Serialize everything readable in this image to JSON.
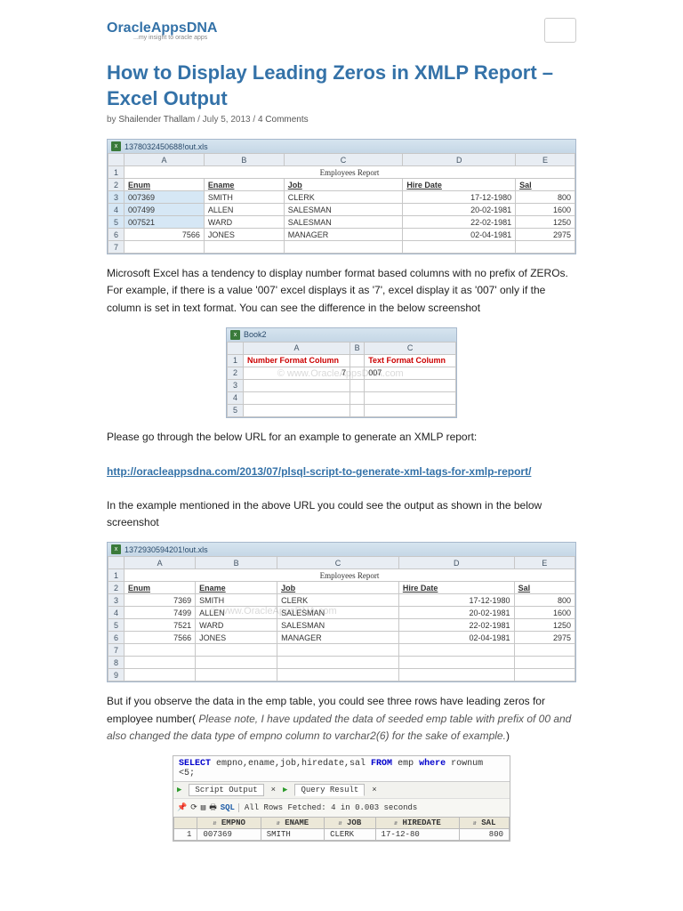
{
  "site": {
    "logo_main": "OracleAppsDNA",
    "logo_sub": "...my insight to oracle apps"
  },
  "article": {
    "title": "How to Display Leading Zeros in XMLP Report – Excel Output",
    "meta": {
      "by": "by",
      "author": "Shailender Thallam",
      "date": "July 5, 2013",
      "comments": "4 Comments"
    },
    "p1": "Microsoft Excel has a tendency to display number format based columns with no prefix of ZEROs. For example, if there is a value '007' excel displays it as '7', excel display it as '007' only if the column is set in text format. You can see the difference in the below screenshot",
    "p2": "Please go through the below URL for an example to generate an XMLP report:",
    "link": "http://oracleappsdna.com/2013/07/plsql-script-to-generate-xml-tags-for-xmlp-report/",
    "p3": "In the example mentioned in the above URL you could see the output as shown in the below screenshot",
    "p4_a": "But if you observe the data in the emp table, you could see three rows have leading zeros for employee number(",
    "p4_b": " Please note, I have updated the data of seeded emp table with prefix of 00 and also changed the data type of empno column to varchar2(6) for the sake of example.",
    "p4_c": ")"
  },
  "excel1": {
    "filename": "1378032450688!out.xls",
    "title": "Employees Report",
    "cols": [
      "A",
      "B",
      "C",
      "D",
      "E"
    ],
    "headers": [
      "Enum",
      "Ename",
      "Job",
      "Hire Date",
      "Sal"
    ],
    "rows": [
      [
        "007369",
        "SMITH",
        "CLERK",
        "17-12-1980",
        "800"
      ],
      [
        "007499",
        "ALLEN",
        "SALESMAN",
        "20-02-1981",
        "1600"
      ],
      [
        "007521",
        "WARD",
        "SALESMAN",
        "22-02-1981",
        "1250"
      ],
      [
        "7566",
        "JONES",
        "MANAGER",
        "02-04-1981",
        "2975"
      ]
    ]
  },
  "excel2": {
    "filename": "Book2",
    "cols": [
      "A",
      "B",
      "C"
    ],
    "h1": "Number Format Column",
    "h2": "Text Format Column",
    "val_num": "7",
    "val_text": "007"
  },
  "excel3": {
    "filename": "1372930594201!out.xls",
    "title": "Employees Report",
    "cols": [
      "A",
      "B",
      "C",
      "D",
      "E"
    ],
    "headers": [
      "Enum",
      "Ename",
      "Job",
      "Hire Date",
      "Sal"
    ],
    "rows": [
      [
        "7369",
        "SMITH",
        "CLERK",
        "17-12-1980",
        "800"
      ],
      [
        "7499",
        "ALLEN",
        "SALESMAN",
        "20-02-1981",
        "1600"
      ],
      [
        "7521",
        "WARD",
        "SALESMAN",
        "22-02-1981",
        "1250"
      ],
      [
        "7566",
        "JONES",
        "MANAGER",
        "02-04-1981",
        "2975"
      ]
    ]
  },
  "sql": {
    "query_pre": "SELECT ",
    "query_cols": "empno,ename,job,hiredate,sal ",
    "query_from": "FROM ",
    "query_tab": "emp ",
    "query_where": "where ",
    "query_cond": "rownum <5;",
    "tab_script": "Script Output",
    "tab_query": "Query Result",
    "fetch": "All Rows Fetched: 4 in 0.003 seconds",
    "sql_label": "SQL",
    "headers": [
      "",
      "EMPNO",
      "ENAME",
      "JOB",
      "HIREDATE",
      "SAL"
    ],
    "row1": [
      "1",
      "007369",
      "SMITH",
      "CLERK",
      "17-12-80",
      "800"
    ]
  }
}
